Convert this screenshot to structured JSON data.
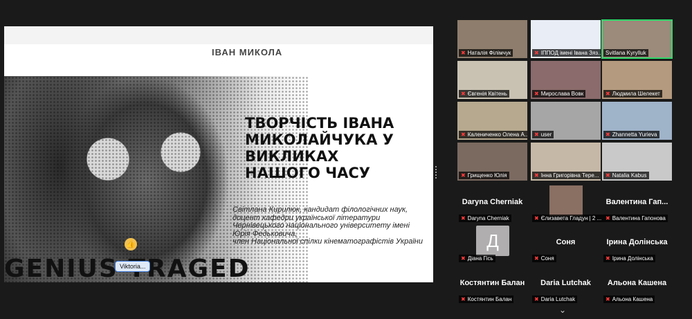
{
  "presentation": {
    "top_fragment": "ІВАН МИКОЛА",
    "title": "ТВОРЧІСТЬ ІВАНА МИКОЛАЙЧУКА У ВИКЛИКАХ НАШОГО ЧАСУ",
    "author": "Світлана Кирилюк, кандидат філологічних наук, доцент кафедри української літератури Чернівецького національного університету імені Юрія Федьковича,",
    "member": "член Національної спілки кінематографістів України",
    "big_text": "GENIUS TRAGED",
    "reaction_icon": "thumbs-up",
    "annotator": "Viktoria..."
  },
  "video_tiles": [
    {
      "name": "Наталія Філімчук",
      "muted": true,
      "bg": "#8e7d6c"
    },
    {
      "name": "ІППОД імені Івана Зяз...",
      "muted": true,
      "bg": "#e9eef6"
    },
    {
      "name": "Svitlana Kyrylluk",
      "muted": false,
      "active": true,
      "bg": "#9c8a7a"
    },
    {
      "name": "Євгенія Квітень",
      "muted": true,
      "bg": "#c9c2b3"
    },
    {
      "name": "Мирослава Вовк",
      "muted": true,
      "bg": "#8b6b6b"
    },
    {
      "name": "Людмила Шелекет",
      "muted": true,
      "bg": "#b49a7e"
    },
    {
      "name": "Калениченко Олена А...",
      "muted": true,
      "bg": "#b6a98f"
    },
    {
      "name": "user",
      "muted": true,
      "bg": "#a6a6a6"
    },
    {
      "name": "Zhannetta Yurieva",
      "muted": true,
      "bg": "#9fb3c9"
    },
    {
      "name": "Грищенко Юлія",
      "muted": true,
      "bg": "#7b6a60"
    },
    {
      "name": "Інна Григорівна Тере...",
      "muted": true,
      "bg": "#c6b8a6"
    },
    {
      "name": "Natalia Kabus",
      "muted": true,
      "bg": "#c9c9c9"
    }
  ],
  "avatar_tiles": [
    {
      "big": "Daryna Cherniak",
      "name": "Daryna Cherniak",
      "type": "name"
    },
    {
      "big": "",
      "name": "Єлизавета Гладун | 2 ...",
      "type": "video",
      "bg": "#8a6f63"
    },
    {
      "big": "Валентина Гап...",
      "name": "Валентина Гапонова",
      "type": "name"
    },
    {
      "big": "Д",
      "name": "Діана Гісь",
      "type": "letter"
    },
    {
      "big": "Соня",
      "name": "Соня",
      "type": "name"
    },
    {
      "big": "Ірина Долінська",
      "name": "Ірина Долінська",
      "type": "name"
    },
    {
      "big": "Костянтин Балан",
      "name": "Костянтин Балан",
      "type": "name"
    },
    {
      "big": "Daria Lutchak",
      "name": "Daria Lutchak",
      "type": "name"
    },
    {
      "big": "Альона Кашена",
      "name": "Альона Кашена",
      "type": "name"
    }
  ],
  "pagination_icon": "chevron-down"
}
